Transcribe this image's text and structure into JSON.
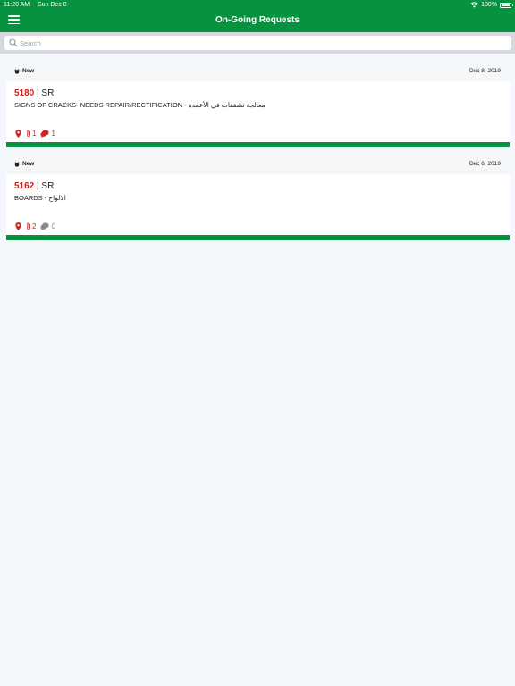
{
  "status_bar": {
    "time": "11:20 AM",
    "date": "Sun Dec 8",
    "battery": "100%"
  },
  "header": {
    "title": "On-Going Requests"
  },
  "search": {
    "placeholder": "Search"
  },
  "colors": {
    "brand_green": "#06923e",
    "request_id_red": "#d11e1e",
    "counter_red": "#c62828",
    "counter_gray": "#8a8a8a"
  },
  "icons": {
    "menu": "hamburger-icon",
    "search": "magnifier-icon",
    "status": "alarm-clock-icon",
    "location": "map-pin-icon",
    "attachment": "paperclip-icon",
    "comments": "speech-bubble-icon"
  },
  "requests": [
    {
      "status": "New",
      "date": "Dec 8, 2019",
      "id": "5180",
      "type": "SR",
      "separator": " | ",
      "description": "SIGNS OF CRACKS- NEEDS REPAIR/RECTIFICATION - معالجة تشققات في الأعمدة",
      "attachments": "1",
      "comments": "1"
    },
    {
      "status": "New",
      "date": "Dec 6, 2019",
      "id": "5162",
      "type": "SR",
      "separator": " | ",
      "description": "BOARDS - الالواح",
      "attachments": "2",
      "comments": "0"
    }
  ]
}
